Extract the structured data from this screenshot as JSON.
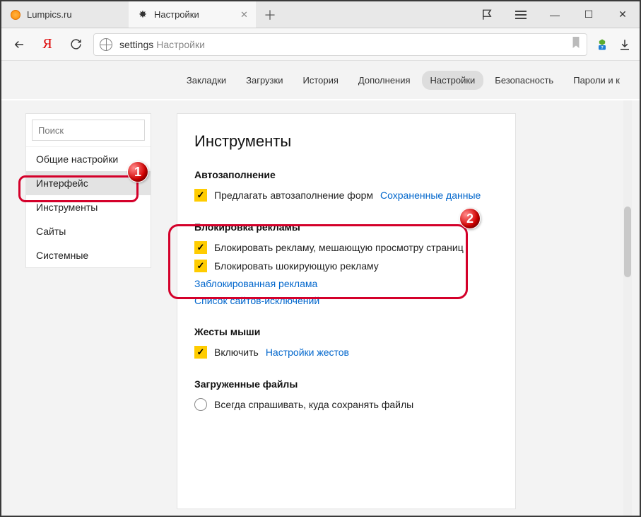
{
  "tabs": [
    {
      "title": "Lumpics.ru"
    },
    {
      "title": "Настройки"
    }
  ],
  "omnibox": {
    "path": "settings",
    "title": "Настройки"
  },
  "topnav": {
    "items": [
      "Закладки",
      "Загрузки",
      "История",
      "Дополнения",
      "Настройки",
      "Безопасность",
      "Пароли и к"
    ],
    "active_index": 4
  },
  "sidebar": {
    "search_placeholder": "Поиск",
    "items": [
      "Общие настройки",
      "Интерфейс",
      "Инструменты",
      "Сайты",
      "Системные"
    ],
    "active_index": 1
  },
  "panel": {
    "title": "Инструменты",
    "autofill": {
      "heading": "Автозаполнение",
      "checkbox_label": "Предлагать автозаполнение форм",
      "link": "Сохраненные данные"
    },
    "adblock": {
      "heading": "Блокировка рекламы",
      "opt1": "Блокировать рекламу, мешающую просмотру страниц",
      "opt2": "Блокировать шокирующую рекламу",
      "link1": "Заблокированная реклама",
      "link2": "Список сайтов-исключений"
    },
    "gestures": {
      "heading": "Жесты мыши",
      "checkbox_label": "Включить",
      "link": "Настройки жестов"
    },
    "downloads": {
      "heading": "Загруженные файлы",
      "radio_label": "Всегда спрашивать, куда сохранять файлы"
    }
  },
  "callouts": {
    "n1": "1",
    "n2": "2"
  }
}
